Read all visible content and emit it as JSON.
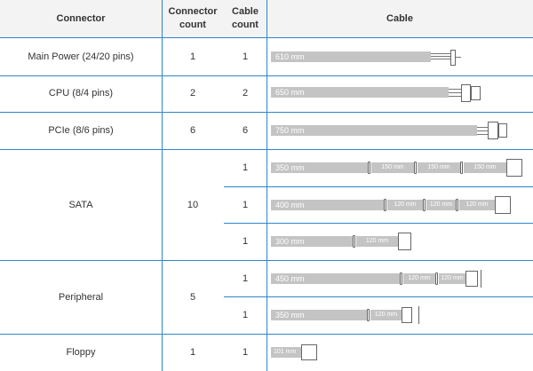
{
  "headers": {
    "connector": "Connector",
    "connector_count": "Connector count",
    "cable_count": "Cable count",
    "cable": "Cable"
  },
  "rows": [
    {
      "name": "Main Power (24/20 pins)",
      "connector_count": "1",
      "cable_count": "1",
      "cable": {
        "main": "610 mm",
        "segments": []
      }
    },
    {
      "name": "CPU (8/4 pins)",
      "connector_count": "2",
      "cable_count": "2",
      "cable": {
        "main": "650 mm",
        "segments": []
      }
    },
    {
      "name": "PCIe (8/6 pins)",
      "connector_count": "6",
      "cable_count": "6",
      "cable": {
        "main": "750 mm",
        "segments": []
      }
    },
    {
      "name": "SATA",
      "connector_count": "10",
      "cables": [
        {
          "cable_count": "1",
          "main": "350 mm",
          "segments": [
            "150 mm",
            "150 mm",
            "150 mm"
          ]
        },
        {
          "cable_count": "1",
          "main": "400 mm",
          "segments": [
            "120 mm",
            "120 mm",
            "120 mm"
          ]
        },
        {
          "cable_count": "1",
          "main": "300 mm",
          "segments": [
            "120 mm"
          ]
        }
      ]
    },
    {
      "name": "Peripheral",
      "connector_count": "5",
      "cables": [
        {
          "cable_count": "1",
          "main": "450 mm",
          "segments": [
            "120 mm",
            "120 mm"
          ]
        },
        {
          "cable_count": "1",
          "main": "350 mm",
          "segments": [
            "120 mm"
          ]
        }
      ]
    },
    {
      "name": "Floppy",
      "connector_count": "1",
      "cable_count": "1",
      "cable": {
        "main": "101 mm",
        "segments": []
      }
    }
  ],
  "colors": {
    "border": "#2f86c8",
    "cable_fill": "#c4c4c4",
    "header_fill": "#f3f3f3",
    "cable_text": "#ffffff"
  }
}
